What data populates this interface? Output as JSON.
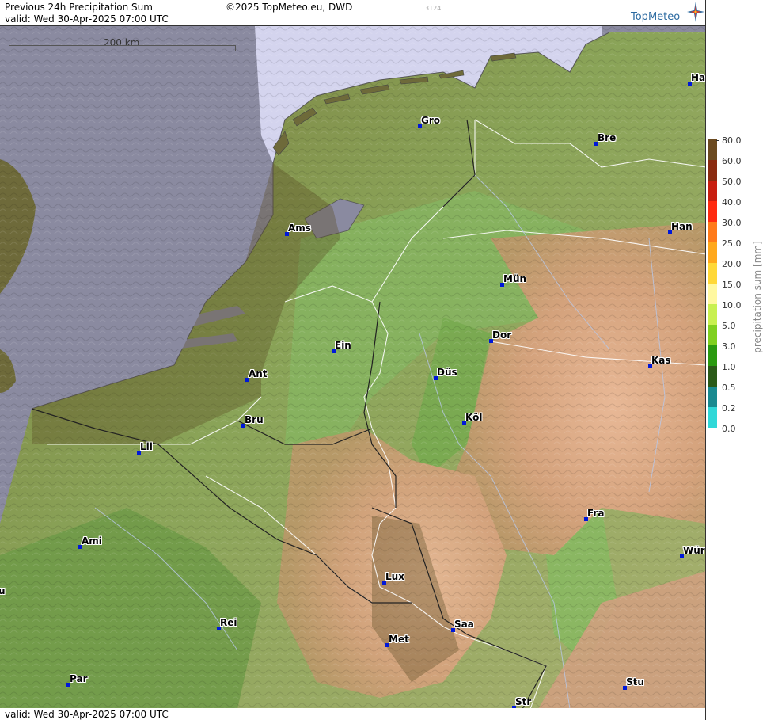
{
  "header": {
    "title": "Previous 24h Precipitation Sum",
    "valid": "valid:  Wed  30-Apr-2025 07:00 UTC",
    "copyright": "©2025 TopMeteo.eu, DWD",
    "image_code": "3124",
    "brand": "TopMeteo"
  },
  "footer": {
    "valid": "valid:  Wed  30-Apr-2025 07:00 UTC"
  },
  "scale": {
    "label": "200 km"
  },
  "legend": {
    "title": "precipitation sum [mm]",
    "entries": [
      {
        "value": "80.0",
        "color": "#6b4a20"
      },
      {
        "value": "60.0",
        "color": "#8a2a10"
      },
      {
        "value": "50.0",
        "color": "#c81e10"
      },
      {
        "value": "40.0",
        "color": "#ff2a10"
      },
      {
        "value": "30.0",
        "color": "#ff7a1a"
      },
      {
        "value": "25.0",
        "color": "#ffa81c"
      },
      {
        "value": "20.0",
        "color": "#ffd838"
      },
      {
        "value": "15.0",
        "color": "#fff8a0"
      },
      {
        "value": "10.0",
        "color": "#c8f050"
      },
      {
        "value": "5.0",
        "color": "#80d020"
      },
      {
        "value": "3.0",
        "color": "#2a9a10"
      },
      {
        "value": "1.0",
        "color": "#2a5a18"
      },
      {
        "value": "0.5",
        "color": "#1a8a90"
      },
      {
        "value": "0.2",
        "color": "#30d8d8"
      },
      {
        "value": "0.0",
        "color": "#c8f8f8"
      }
    ],
    "last_label": "0.0"
  },
  "cities": [
    {
      "key": "ha",
      "name": "Ha"
    },
    {
      "key": "gro",
      "name": "Gro"
    },
    {
      "key": "bre",
      "name": "Bre"
    },
    {
      "key": "han",
      "name": "Han"
    },
    {
      "key": "ams",
      "name": "Ams"
    },
    {
      "key": "mun",
      "name": "Mün"
    },
    {
      "key": "dor",
      "name": "Dor"
    },
    {
      "key": "ein",
      "name": "Ein"
    },
    {
      "key": "kas",
      "name": "Kas"
    },
    {
      "key": "ant",
      "name": "Ant"
    },
    {
      "key": "dus",
      "name": "Düs"
    },
    {
      "key": "bru",
      "name": "Bru"
    },
    {
      "key": "kol",
      "name": "Köl"
    },
    {
      "key": "lil",
      "name": "Lil"
    },
    {
      "key": "fra",
      "name": "Fra"
    },
    {
      "key": "ami",
      "name": "Ami"
    },
    {
      "key": "wur",
      "name": "Wür"
    },
    {
      "key": "lux",
      "name": "Lux"
    },
    {
      "key": "u",
      "name": "u"
    },
    {
      "key": "rei",
      "name": "Rei"
    },
    {
      "key": "saa",
      "name": "Saa"
    },
    {
      "key": "met",
      "name": "Met"
    },
    {
      "key": "stu",
      "name": "Stu"
    },
    {
      "key": "par",
      "name": "Par"
    },
    {
      "key": "str",
      "name": "Str"
    }
  ],
  "colors": {
    "sea": "#8a8aa0",
    "radar_sea": "#d4d4ee",
    "lowland": "#6e6a3a",
    "green": "#7aa858",
    "highland": "#d8a888",
    "city_dot": "#0018d8"
  }
}
